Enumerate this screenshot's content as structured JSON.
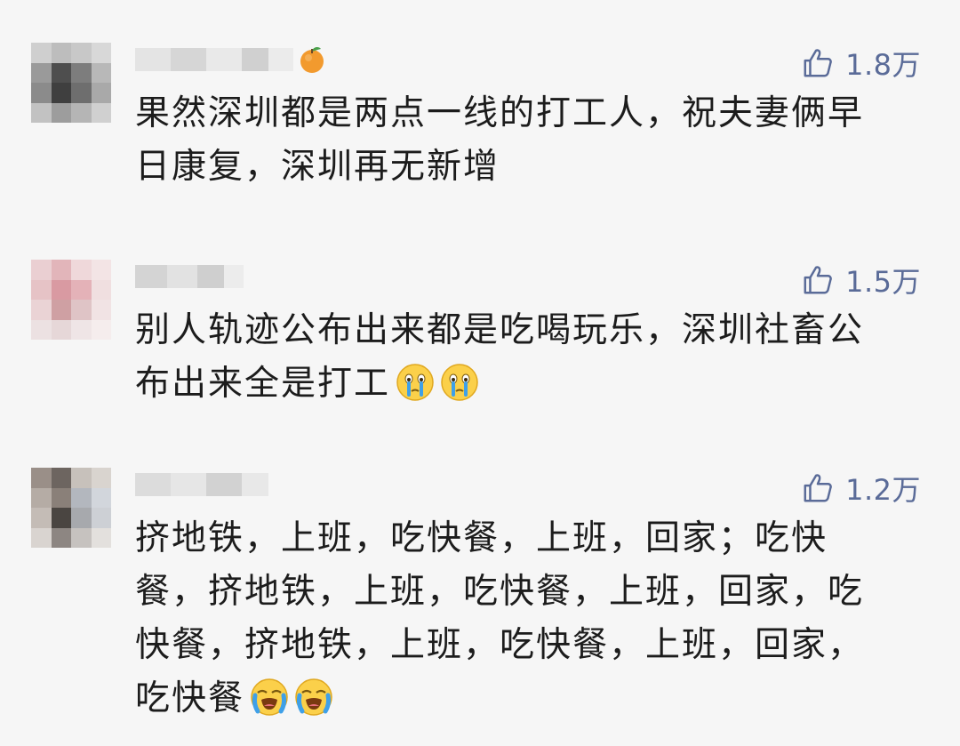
{
  "comments": [
    {
      "likes": "1.8万",
      "text": "果然深圳都是两点一线的打工人，祝夫妻俩早日康复，深圳再无新增",
      "name_badge_icon": "orange-icon",
      "emojis": []
    },
    {
      "likes": "1.5万",
      "text": "别人轨迹公布出来都是吃喝玩乐，深圳社畜公布出来全是打工",
      "emojis": [
        "crying-face-emoji",
        "crying-face-emoji"
      ]
    },
    {
      "likes": "1.2万",
      "text": "挤地铁，上班，吃快餐，上班，回家；吃快餐，挤地铁，上班，吃快餐，上班，回家，吃快餐，挤地铁，上班，吃快餐，上班，回家，吃快餐",
      "emojis": [
        "loudly-crying-face-emoji",
        "loudly-crying-face-emoji"
      ]
    }
  ],
  "colors": {
    "background": "#f6f6f6",
    "like_color": "#5a6b98",
    "text": "#1c1c1c"
  }
}
